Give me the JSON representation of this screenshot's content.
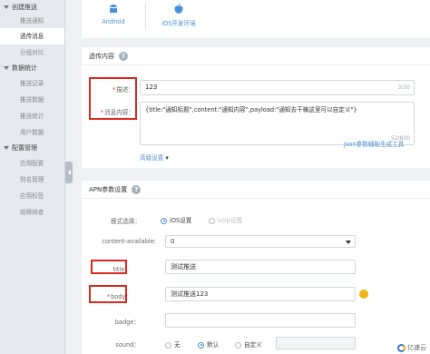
{
  "sidebar": {
    "groups": [
      {
        "label": "创建推送",
        "items": [
          "推送通知",
          "透传消息",
          "分组对比"
        ]
      },
      {
        "label": "数据统计",
        "items": [
          "推送记录",
          "推送数据",
          "推送统计",
          "用户数据"
        ]
      },
      {
        "label": "配置管理",
        "items": [
          "应用配置",
          "别名管理",
          "应用标签",
          "故障排查"
        ]
      }
    ],
    "active_item": "透传消息"
  },
  "platforms": {
    "android": "Android",
    "ios": "iOS开发环境"
  },
  "content_card": {
    "title": "透传内容",
    "desc_label": "描述：",
    "desc_value": "123",
    "desc_counter": "3/30",
    "msg_label": "消息内容：",
    "msg_value": "{title:\"通知标题\",content:\"通知内容\",payload:\"通知去干嘛这里可以自定义\"}",
    "msg_counter": "52/800",
    "json_link": "Json参数辅助生成工具",
    "advanced_link": "高级设置"
  },
  "apn_card": {
    "title": "APN参数设置",
    "mode_label": "模式选择：",
    "mode_ios": "iOS设置",
    "mode_voip": "voip设置",
    "content_available_label": "content-available:",
    "content_available_value": "0",
    "title_label": "title：",
    "title_value": "测试推送",
    "body_label": "body：",
    "body_value": "测试推送123",
    "badge_label": "badge：",
    "sound_label": "sound：",
    "sound_none": "无",
    "sound_default": "默认",
    "sound_custom": "自定义"
  },
  "watermark": "亿速云",
  "colors": {
    "accent": "#4a90d9",
    "highlight": "#d9281e",
    "required": "#e33"
  }
}
